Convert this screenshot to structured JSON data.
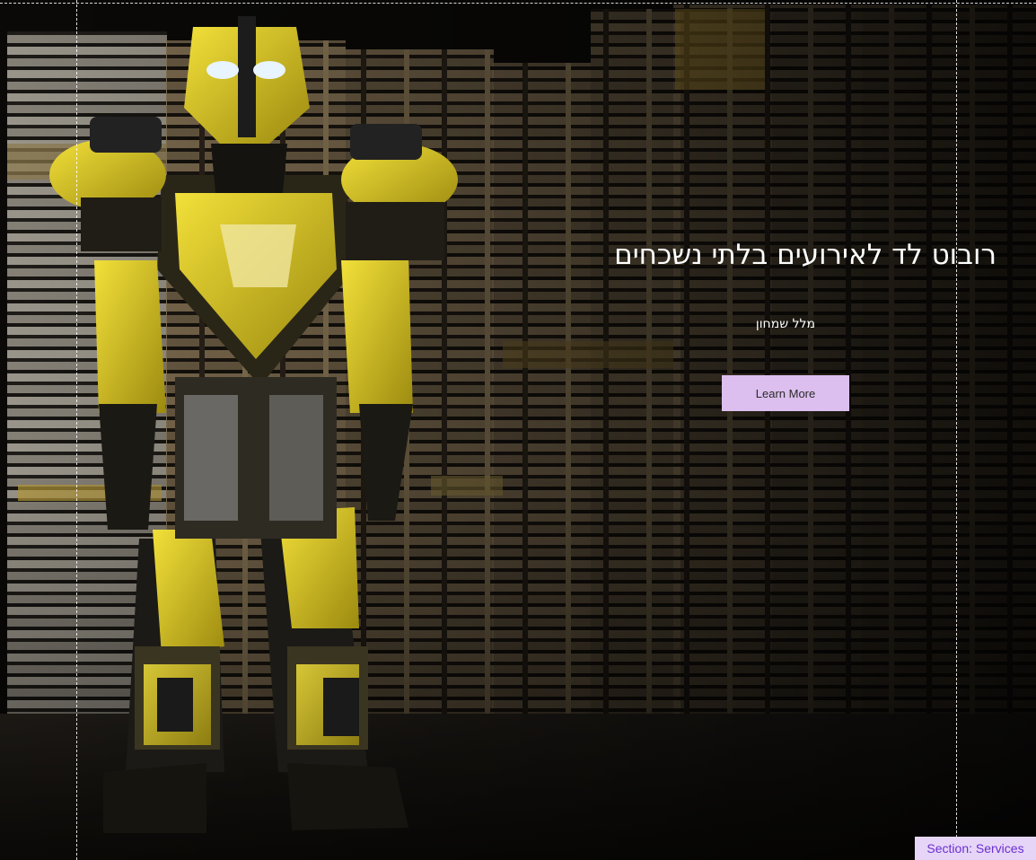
{
  "hero": {
    "title": "רובוט לד לאירועים בלתי נשכחים",
    "subtitle": "מלל שמחון",
    "button_label": "Learn More"
  },
  "editor": {
    "section_label": "Section: Services"
  },
  "colors": {
    "button_bg": "#dcbfee",
    "section_label_bg": "#e6d5f7",
    "section_label_text": "#6b2fd0",
    "robot_yellow": "#d9c320"
  },
  "image": {
    "subject": "yellow-led-robot-costume-in-front-of-wooden-pallets"
  }
}
